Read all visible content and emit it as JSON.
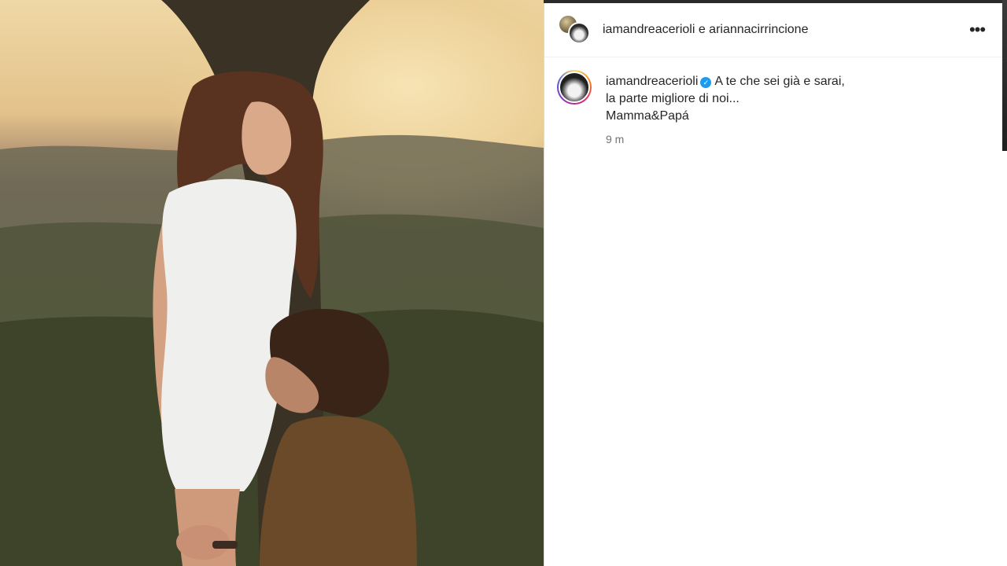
{
  "post": {
    "header": {
      "title": "iamandreacerioli e ariannacirrincione",
      "more_icon": "more-horizontal-icon",
      "more_label": "•••"
    },
    "caption": {
      "username": "iamandreacerioli",
      "verified_icon": "verified-badge-icon",
      "verified_mark": "✓",
      "lines": [
        "A te che sei già e sarai,",
        "la parte migliore di noi...",
        "Mamma&Papá"
      ],
      "time": "9 m"
    }
  },
  "colors": {
    "verified": "#1d9bf0",
    "text": "#262626",
    "secondary_text": "#737373",
    "border": "#dbdbdb"
  }
}
